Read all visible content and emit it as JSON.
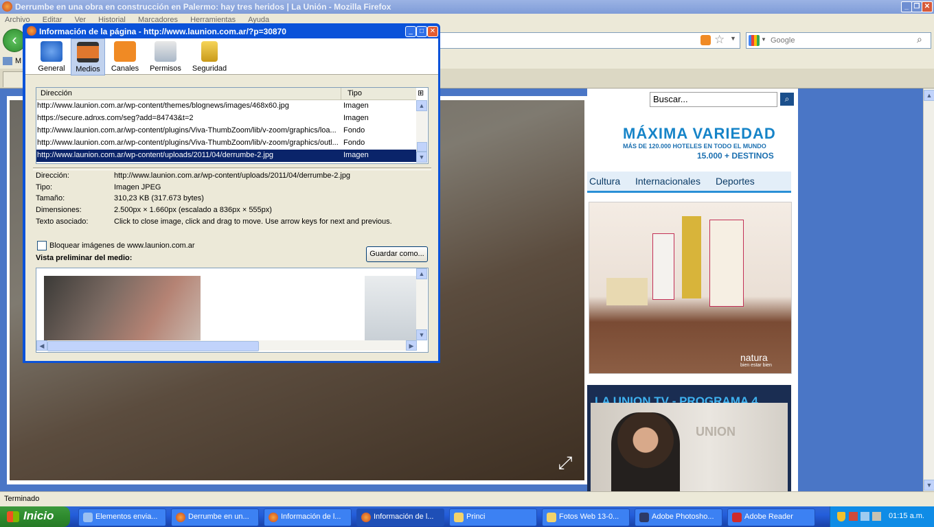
{
  "firefox": {
    "window_title": "Derrumbe en una obra en construcción en Palermo: hay tres heridos | La Unión - Mozilla Firefox",
    "menu": [
      "Archivo",
      "Editar",
      "Ver",
      "Historial",
      "Marcadores",
      "Herramientas",
      "Ayuda"
    ],
    "search_placeholder": "Google",
    "bookmark_label": "M",
    "status_text": "Terminado"
  },
  "page": {
    "search_placeholder": "Buscar...",
    "ad": {
      "line1": "MÁXIMA VARIEDAD",
      "line2": "MÁS DE 120.000 HOTELES EN TODO EL MUNDO",
      "line3": "15.000 + DESTINOS"
    },
    "categories": [
      "Cultura",
      "Internacionales",
      "Deportes"
    ],
    "natura_brand": "natura",
    "natura_tagline": "bien estar bien",
    "tv_title": "LA UNION TV - PROGRAMA 4",
    "tv_sign": "UNION"
  },
  "dialog": {
    "title": "Información de la página - http://www.launion.com.ar/?p=30870",
    "tabs": [
      {
        "label": "General",
        "icon": "info-icon"
      },
      {
        "label": "Medios",
        "icon": "media-icon"
      },
      {
        "label": "Canales",
        "icon": "rss-icon"
      },
      {
        "label": "Permisos",
        "icon": "permissions-icon"
      },
      {
        "label": "Seguridad",
        "icon": "lock-icon"
      }
    ],
    "selected_tab": "Medios",
    "columns": [
      "Dirección",
      "Tipo"
    ],
    "rows": [
      {
        "address": "http://www.launion.com.ar/wp-content/themes/blognews/images/468x60.jpg",
        "type": "Imagen"
      },
      {
        "address": "https://secure.adnxs.com/seg?add=84743&t=2",
        "type": "Imagen"
      },
      {
        "address": "http://www.launion.com.ar/wp-content/plugins/Viva-ThumbZoom/lib/v-zoom/graphics/loa...",
        "type": "Fondo"
      },
      {
        "address": "http://www.launion.com.ar/wp-content/plugins/Viva-ThumbZoom/lib/v-zoom/graphics/outl...",
        "type": "Fondo"
      },
      {
        "address": "http://www.launion.com.ar/wp-content/uploads/2011/04/derrumbe-2.jpg",
        "type": "Imagen"
      }
    ],
    "details": {
      "address_label": "Dirección:",
      "address": "http://www.launion.com.ar/wp-content/uploads/2011/04/derrumbe-2.jpg",
      "type_label": "Tipo:",
      "type": "Imagen JPEG",
      "size_label": "Tamaño:",
      "size": "310,23 KB (317.673 bytes)",
      "dims_label": "Dimensiones:",
      "dims": "2.500px × 1.660px (escalado a 836px × 555px)",
      "alt_label": "Texto asociado:",
      "alt": "Click to close image, click and drag to move. Use arrow keys for next and previous."
    },
    "block_label": "Bloquear imágenes de www.launion.com.ar",
    "save_label": "Guardar como...",
    "preview_label": "Vista preliminar del medio:"
  },
  "taskbar": {
    "start_label": "Inicio",
    "tasks": [
      "Elementos envia...",
      "Derrumbe en un...",
      "Información de l...",
      "Información de l...",
      "Princi",
      "Fotos Web 13-0...",
      "Adobe Photosho...",
      "Adobe Reader"
    ],
    "clock": "01:15 a.m."
  },
  "colors": {
    "xp_blue": "#0a52d9",
    "selection": "#0a246a",
    "taskbar": "#245edb",
    "start_green": "#2e8b2e"
  }
}
